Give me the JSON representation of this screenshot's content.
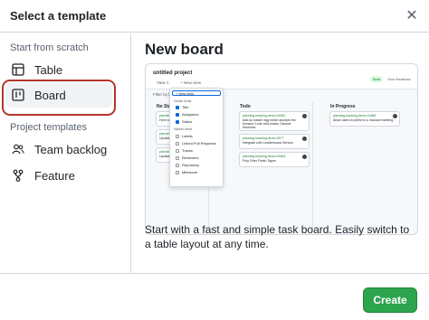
{
  "dialog": {
    "title": "Select a template",
    "close_icon": "close-icon"
  },
  "sidebar": {
    "scratch_heading": "Start from scratch",
    "scratch_items": [
      {
        "label": "Table",
        "icon": "table-icon"
      },
      {
        "label": "Board",
        "icon": "board-icon",
        "selected": true
      }
    ],
    "project_heading": "Project templates",
    "project_items": [
      {
        "label": "Team backlog",
        "icon": "people-icon"
      },
      {
        "label": "Feature",
        "icon": "feature-icon"
      }
    ]
  },
  "main": {
    "title": "New board",
    "description": "Start with a fast and simple task board. Easily switch to a table layout at any time.",
    "preview": {
      "project_name": "untitled project",
      "tabs": [
        "View 1",
        "+ New view"
      ],
      "badges": [
        "Beta",
        "Give feedback"
      ],
      "filter_placeholder": "Filter by keyword or by field",
      "columns": [
        {
          "title": "No Status",
          "cards": [
            {
              "meta": "planning-tracking-demo #1",
              "text": "Here sho..."
            },
            {
              "meta": "planning-tracking-demo #3",
              "text": "Updates ..."
            },
            {
              "meta": "planning-tracking-demo #4",
              "text": "Updates ..."
            }
          ]
        },
        {
          "title": "Todo",
          "cards": [
            {
              "meta": "planning-tracking-demo #1650",
              "text": "Add an easter egg which accepts the Konami Code and shows Octocat fireworks"
            },
            {
              "meta": "planning-tracking-demo #877",
              "text": "Integrate with Leaderboard Service"
            },
            {
              "meta": "planning-tracking-demo #1664",
              "text": "Poly Filter Finish Tapes"
            }
          ]
        },
        {
          "title": "In Progress",
          "cards": [
            {
              "meta": "planning-tracking-demo #1665",
              "text": "Allow users to perform a manual resetting"
            }
          ]
        }
      ],
      "field_menu": {
        "new_field": "+ New field",
        "visible_heading": "Visible fields",
        "visible": [
          "Title",
          "Assignees",
          "Status"
        ],
        "hidden_heading": "Hidden fields",
        "hidden": [
          "Labels",
          "Linked Pull Requests",
          "Tracks",
          "Reviewers",
          "Repository",
          "Milestone"
        ]
      }
    }
  },
  "footer": {
    "create_label": "Create"
  },
  "colors": {
    "accent_green": "#2da44e",
    "highlight_red": "#b4352c",
    "border": "#d0d7de"
  }
}
